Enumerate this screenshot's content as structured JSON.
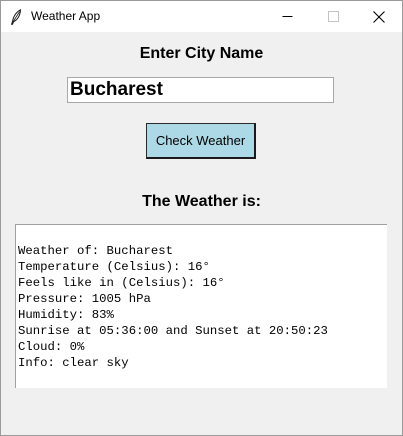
{
  "window": {
    "title": "Weather App",
    "icon": "feather-icon",
    "controls": [
      "minimize-icon",
      "maximize-icon",
      "close-icon"
    ]
  },
  "city_heading": "Enter City Name",
  "city_input": {
    "value": "Bucharest"
  },
  "check_button": {
    "label": "Check Weather",
    "color": "#add8e6"
  },
  "result_heading": "The Weather is:",
  "result_lines": [
    "Weather of: Bucharest",
    "Temperature (Celsius): 16°",
    "Feels like in (Celsius): 16°",
    "Pressure: 1005 hPa",
    "Humidity: 83%",
    "Sunrise at 05:36:00 and Sunset at 20:50:23",
    "Cloud: 0%",
    "Info: clear sky"
  ],
  "colors": {
    "background": "#f0f0f0",
    "button": "#add8e6",
    "text_box": "#ffffff"
  }
}
